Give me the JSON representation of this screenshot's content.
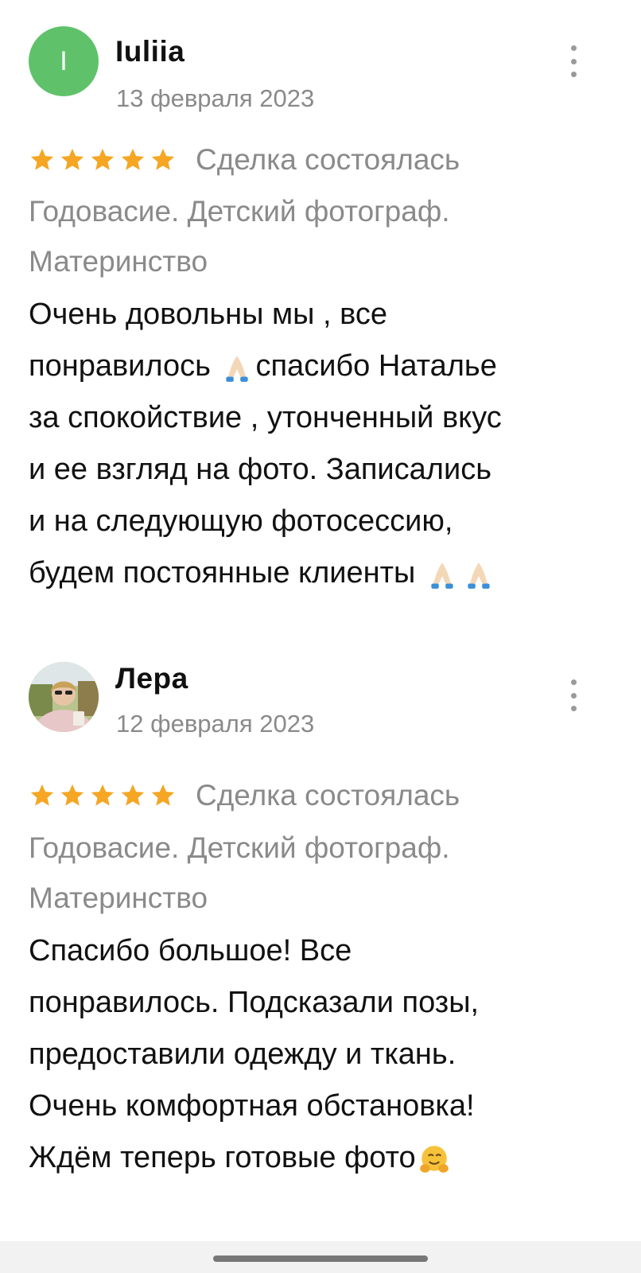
{
  "reviews": [
    {
      "avatar_letter": "I",
      "author": "Iuliia",
      "date": "13 февраля 2023",
      "rating": 5,
      "deal_status": "Сделка состоялась",
      "service_lines": [
        "Годовасие. Детский фотограф.",
        "Материнство"
      ],
      "body_lines": [
        "Очень довольны мы , все",
        "понравилось",
        "спасибо Наталье",
        "за спокойствие , утонченный вкус",
        "и ее взгляд на фото. Записались",
        "и на следующую фотосессию,",
        "будем постоянные клиенты"
      ],
      "menu_icon": "more-vertical-icon"
    },
    {
      "author": "Лера",
      "date": "12 февраля 2023",
      "rating": 5,
      "deal_status": "Сделка состоялась",
      "service_lines": [
        "Годовасие. Детский фотограф.",
        "Материнство"
      ],
      "body_lines": [
        "Спасибо большое! Все",
        "понравилось. Подсказали позы,",
        "предоставили одежду и ткань.",
        "Очень комфортная обстановка!",
        "Ждём теперь готовые фото"
      ],
      "menu_icon": "more-vertical-icon"
    }
  ],
  "colors": {
    "avatar_green": "#5fc26a",
    "star": "#f5a623",
    "secondary_text": "#8a8a8a",
    "primary_text": "#111111"
  }
}
